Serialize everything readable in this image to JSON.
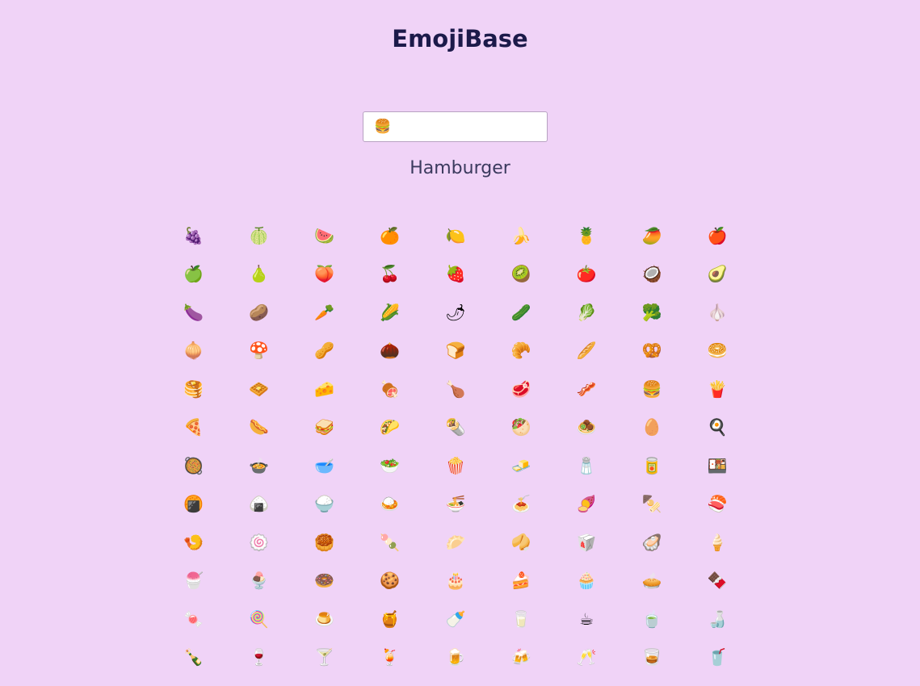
{
  "header": {
    "title": "EmojiBase"
  },
  "search": {
    "value": "🍔",
    "placeholder": ""
  },
  "selected": {
    "name": "Hamburger"
  },
  "emojis": [
    "🍇",
    "🍈",
    "🍉",
    "🍊",
    "🍋",
    "🍌",
    "🍍",
    "🥭",
    "🍎",
    "🍏",
    "🍐",
    "🍑",
    "🍒",
    "🍓",
    "🥝",
    "🍅",
    "🥥",
    "🥑",
    "🍆",
    "🥔",
    "🥕",
    "🌽",
    "🌶",
    "🥒",
    "🥬",
    "🥦",
    "🧄",
    "🧅",
    "🍄",
    "🥜",
    "🌰",
    "🍞",
    "🥐",
    "🥖",
    "🥨",
    "🥯",
    "🥞",
    "🧇",
    "🧀",
    "🍖",
    "🍗",
    "🥩",
    "🥓",
    "🍔",
    "🍟",
    "🍕",
    "🌭",
    "🥪",
    "🌮",
    "🌯",
    "🥙",
    "🧆",
    "🥚",
    "🍳",
    "🥘",
    "🍲",
    "🥣",
    "🥗",
    "🍿",
    "🧈",
    "🧂",
    "🥫",
    "🍱",
    "🍘",
    "🍙",
    "🍚",
    "🍛",
    "🍜",
    "🍝",
    "🍠",
    "🍢",
    "🍣",
    "🍤",
    "🍥",
    "🥮",
    "🍡",
    "🥟",
    "🥠",
    "🥡",
    "🦪",
    "🍦",
    "🍧",
    "🍨",
    "🍩",
    "🍪",
    "🎂",
    "🍰",
    "🧁",
    "🥧",
    "🍫",
    "🍬",
    "🍭",
    "🍮",
    "🍯",
    "🍼",
    "🥛",
    "☕",
    "🍵",
    "🍶",
    "🍾",
    "🍷",
    "🍸",
    "🍹",
    "🍺",
    "🍻",
    "🥂",
    "🥃",
    "🥤"
  ]
}
